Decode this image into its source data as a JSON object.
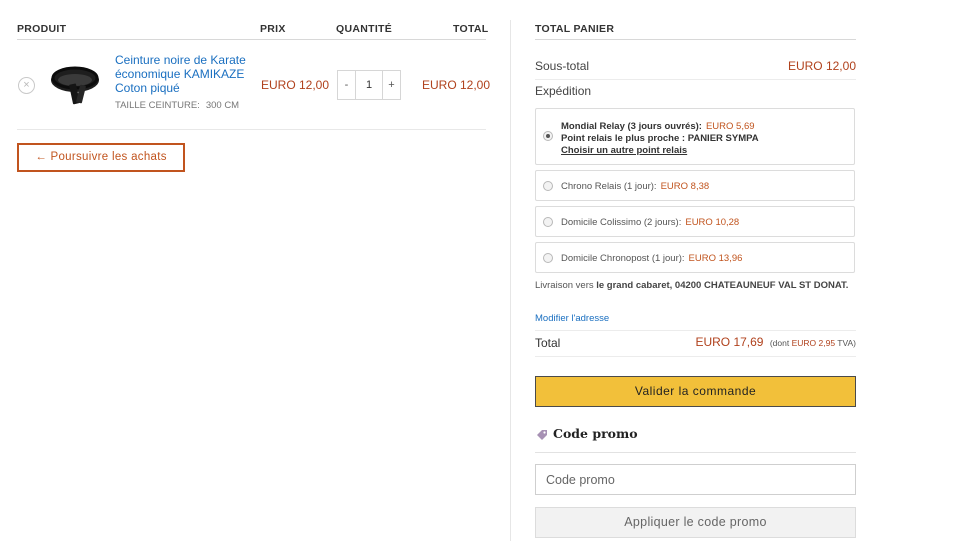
{
  "cart_table": {
    "headers": {
      "product": "PRODUIT",
      "price": "PRIX",
      "quantity": "QUANTITÉ",
      "total": "TOTAL"
    },
    "item": {
      "remove_symbol": "×",
      "name": "Ceinture noire de Karate économique KAMIKAZE Coton piqué",
      "variation_label": "TAILLE CEINTURE:",
      "variation_value": "300 CM",
      "price": "EURO 12,00",
      "quantity": "1",
      "qty_minus": "-",
      "qty_plus": "+",
      "line_total": "EURO 12,00"
    },
    "continue_label": "← Poursuivre les achats"
  },
  "cart_totals": {
    "title": "TOTAL PANIER",
    "subtotal_label": "Sous-total",
    "subtotal_value": "EURO 12,00",
    "shipping_label": "Expédition",
    "shipping_options": {
      "selected": {
        "name": "Mondial Relay (3 jours ouvrés):",
        "price": "EURO 5,69",
        "relay_text": "Point relais le plus proche : PANIER SYMPA",
        "relay_link": "Choisir un autre point relais"
      },
      "chrono_relais": {
        "name": "Chrono Relais (1 jour):",
        "price": "EURO 8,38"
      },
      "colissimo": {
        "name": "Domicile Colissimo (2 jours):",
        "price": "EURO 10,28"
      },
      "chronopost": {
        "name": "Domicile Chronopost (1 jour):",
        "price": "EURO 13,96"
      }
    },
    "delivery_prefix": "Livraison vers",
    "delivery_address": "le grand cabaret, 04200 CHATEAUNEUF VAL ST DONAT.",
    "modify_address": "Modifier l'adresse",
    "total_label": "Total",
    "total_value": "EURO 17,69",
    "tax_prefix": "(dont",
    "tax_value": "EURO 2,95",
    "tax_suffix": "TVA)",
    "validate_label": "Valider la commande"
  },
  "promo": {
    "title": "Code promo",
    "placeholder": "Code promo",
    "apply_label": "Appliquer le code promo"
  },
  "colors": {
    "accent_orange": "#c1541e",
    "price_red": "#b0411c",
    "link_blue": "#1a6fc0",
    "button_yellow": "#f2c03a"
  },
  "icons": {
    "remove": "remove-item-icon",
    "tag": "tag-icon",
    "radio": "radio-icon"
  }
}
